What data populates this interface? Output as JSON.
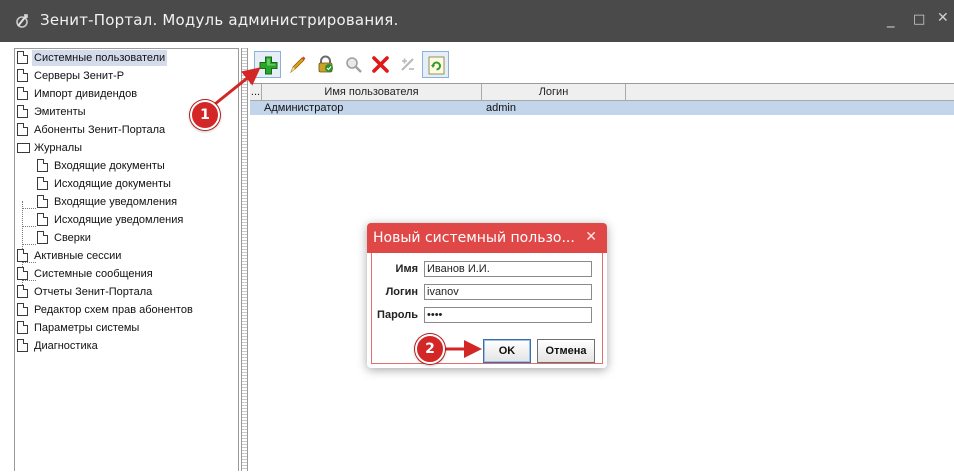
{
  "window": {
    "title": "Зенит-Портал. Модуль администрирования.",
    "controls": {
      "minimize": "_",
      "maximize": "□",
      "close": "✕"
    }
  },
  "tree": {
    "items": [
      {
        "label": "Системные пользователи",
        "icon": "document-icon",
        "selected": true
      },
      {
        "label": "Серверы Зенит-Р",
        "icon": "document-icon"
      },
      {
        "label": "Импорт дивидендов",
        "icon": "document-icon"
      },
      {
        "label": "Эмитенты",
        "icon": "document-icon"
      },
      {
        "label": "Абоненты Зенит-Портала",
        "icon": "document-icon"
      },
      {
        "label": "Журналы",
        "icon": "folder-icon"
      },
      {
        "label": "Входящие документы",
        "icon": "document-icon",
        "child": true
      },
      {
        "label": "Исходящие документы",
        "icon": "document-icon",
        "child": true
      },
      {
        "label": "Входящие уведомления",
        "icon": "document-icon",
        "child": true
      },
      {
        "label": "Исходящие уведомления",
        "icon": "document-icon",
        "child": true
      },
      {
        "label": "Сверки",
        "icon": "document-icon",
        "child": true
      },
      {
        "label": "Активные сессии",
        "icon": "document-icon"
      },
      {
        "label": "Системные сообщения",
        "icon": "document-icon"
      },
      {
        "label": "Отчеты Зенит-Портала",
        "icon": "document-icon"
      },
      {
        "label": "Редактор схем прав абонентов",
        "icon": "document-icon"
      },
      {
        "label": "Параметры системы",
        "icon": "document-icon"
      },
      {
        "label": "Диагностика",
        "icon": "document-icon"
      }
    ]
  },
  "toolbar": {
    "buttons": [
      "add-icon",
      "edit-icon",
      "lock-icon",
      "search-icon",
      "delete-icon",
      "disabled-tool-icon",
      "refresh-icon"
    ]
  },
  "grid": {
    "columns": [
      "...",
      "Имя пользователя",
      "Логин"
    ],
    "rows": [
      {
        "name": "Администратор",
        "login": "admin"
      }
    ]
  },
  "dialog": {
    "title": "Новый системный пользо...",
    "close": "✕",
    "name_label": "Имя",
    "name_value": "Иванов И.И.",
    "login_label": "Логин",
    "login_value": "ivanov",
    "password_label": "Пароль",
    "password_value": "••••",
    "ok_label": "OK",
    "cancel_label": "Отмена"
  },
  "annotations": {
    "badge1": "1",
    "badge2": "2",
    "color": "#d32727"
  },
  "colors": {
    "titlebar": "#4a4a4a",
    "dialog_title": "#e04848",
    "selection": "#c3d5ea"
  }
}
